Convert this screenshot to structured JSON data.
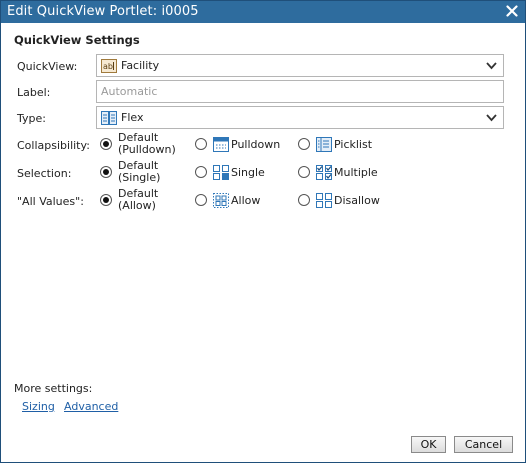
{
  "dialog": {
    "title": "Edit QuickView Portlet: i0005",
    "close_icon": "close-icon"
  },
  "settings": {
    "section_title": "QuickView Settings",
    "quickview": {
      "label": "QuickView:",
      "value": "Facility",
      "icon": "text-field-icon"
    },
    "label_field": {
      "label": "Label:",
      "placeholder": "Automatic",
      "value": ""
    },
    "type": {
      "label": "Type:",
      "value": "Flex",
      "icon": "flex-list-icon"
    }
  },
  "collapsibility": {
    "label": "Collapsibility:",
    "options": [
      {
        "line1": "Default",
        "line2": "(Pulldown)",
        "selected": true,
        "icon": ""
      },
      {
        "text": "Pulldown",
        "selected": false,
        "icon": "pulldown-icon"
      },
      {
        "text": "Picklist",
        "selected": false,
        "icon": "picklist-icon"
      }
    ]
  },
  "selection": {
    "label": "Selection:",
    "options": [
      {
        "line1": "Default",
        "line2": "(Single)",
        "selected": true,
        "icon": ""
      },
      {
        "text": "Single",
        "selected": false,
        "icon": "single-select-icon"
      },
      {
        "text": "Multiple",
        "selected": false,
        "icon": "multiple-select-icon"
      }
    ]
  },
  "all_values": {
    "label": "\"All Values\":",
    "options": [
      {
        "line1": "Default",
        "line2": "(Allow)",
        "selected": true,
        "icon": ""
      },
      {
        "text": "Allow",
        "selected": false,
        "icon": "allow-all-icon"
      },
      {
        "text": "Disallow",
        "selected": false,
        "icon": "disallow-all-icon"
      }
    ]
  },
  "more": {
    "label": "More settings:",
    "links": [
      "Sizing",
      "Advanced"
    ]
  },
  "buttons": {
    "ok": "OK",
    "cancel": "Cancel"
  },
  "colors": {
    "titlebar": "#2e6c9e",
    "link": "#1f5fa6",
    "icon_blue": "#2f77b8"
  }
}
